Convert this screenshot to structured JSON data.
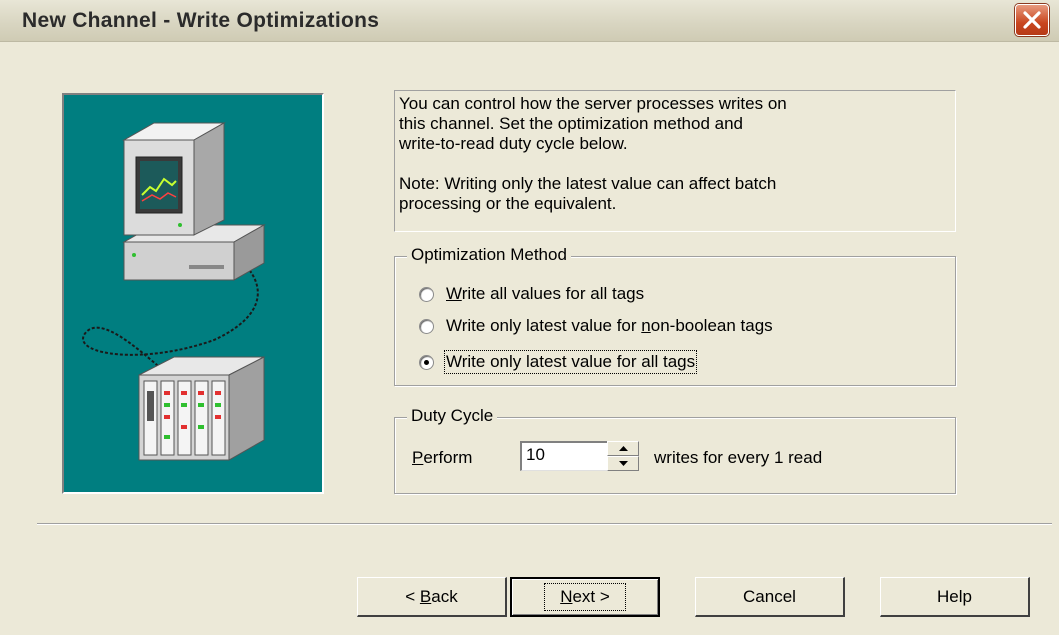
{
  "window": {
    "title": "New Channel - Write Optimizations"
  },
  "description": {
    "text": "You can control how the server processes writes on\nthis channel.  Set the optimization method and\nwrite-to-read duty cycle below.\n\nNote:  Writing only the latest value can affect batch\nprocessing or the equivalent."
  },
  "optimization": {
    "legend": "Optimization Method",
    "options": [
      {
        "pre": "",
        "key": "W",
        "post": "rite all values for all tags",
        "checked": false
      },
      {
        "pre": "Write only latest value for ",
        "key": "n",
        "post": "on-boolean tags",
        "checked": false
      },
      {
        "pre": "Write only latest value for all tags",
        "key": "",
        "post": "",
        "checked": true
      }
    ]
  },
  "duty_cycle": {
    "legend": "Duty Cycle",
    "perform_key": "P",
    "perform_rest": "erform",
    "value": "10",
    "suffix": "writes for every 1 read"
  },
  "buttons": {
    "back_pre": "< ",
    "back_key": "B",
    "back_rest": "ack",
    "next_key": "N",
    "next_rest": "ext >",
    "cancel": "Cancel",
    "help": "Help"
  },
  "colors": {
    "image_bg": "#007e80",
    "dialog_bg": "#ece9d8"
  }
}
